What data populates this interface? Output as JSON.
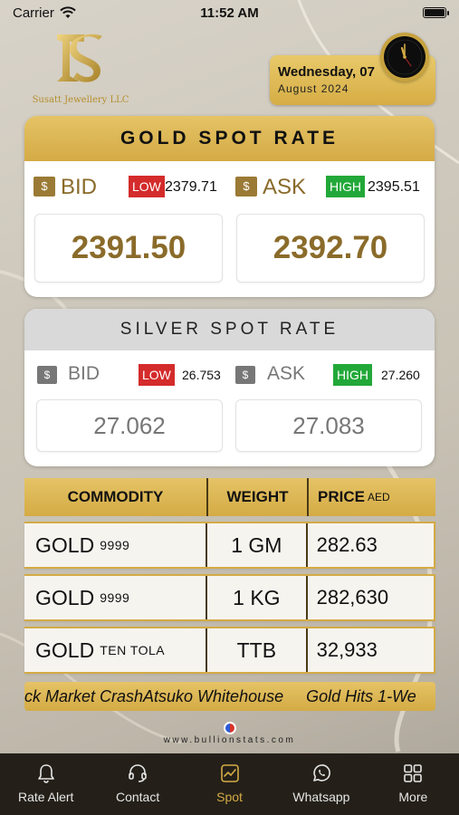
{
  "status_bar": {
    "carrier": "Carrier",
    "time": "11:52 AM",
    "battery_level": 1.0
  },
  "logo": {
    "company": "Susatt Jewellery LLC"
  },
  "date_card": {
    "day_line": "Wednesday, 07",
    "month_line": "August 2024"
  },
  "gold": {
    "title": "GOLD SPOT RATE",
    "bid_label": "BID",
    "ask_label": "ASK",
    "currency_symbol": "$",
    "low_label": "LOW",
    "high_label": "HIGH",
    "low_value": "2379.71",
    "high_value": "2395.51",
    "bid_value": "2391.50",
    "ask_value": "2392.70"
  },
  "silver": {
    "title": "SILVER SPOT RATE",
    "bid_label": "BID",
    "ask_label": "ASK",
    "currency_symbol": "$",
    "low_label": "LOW",
    "high_label": "HIGH",
    "low_value": "26.753",
    "high_value": "27.260",
    "bid_value": "27.062",
    "ask_value": "27.083"
  },
  "table": {
    "headers": {
      "commodity": "COMMODITY",
      "weight": "WEIGHT",
      "price": "PRICE",
      "price_unit": "AED"
    },
    "rows": [
      {
        "name": "GOLD",
        "purity": "9999",
        "weight": "1 GM",
        "price": "282.63"
      },
      {
        "name": "GOLD",
        "purity": "9999",
        "weight": "1 KG",
        "price": "282,630"
      },
      {
        "name": "GOLD",
        "purity": "TEN TOLA",
        "weight": "TTB",
        "price": "32,933"
      }
    ]
  },
  "ticker": {
    "text": "ck Market CrashAtsuko Whitehouse     Gold Hits 1-We"
  },
  "footer": {
    "powered_by": "www.bullionstats.com"
  },
  "nav": {
    "items": [
      {
        "label": "Rate Alert",
        "icon": "bell-icon"
      },
      {
        "label": "Contact",
        "icon": "headset-icon"
      },
      {
        "label": "Spot",
        "icon": "chart-icon"
      },
      {
        "label": "Whatsapp",
        "icon": "whatsapp-icon"
      },
      {
        "label": "More",
        "icon": "grid-icon"
      }
    ],
    "active_index": 2
  },
  "colors": {
    "gold": "#d4ab45",
    "gold_text": "#8a6b2a",
    "low": "#d42b2b",
    "high": "#22a838",
    "nav_bg": "#242019"
  }
}
